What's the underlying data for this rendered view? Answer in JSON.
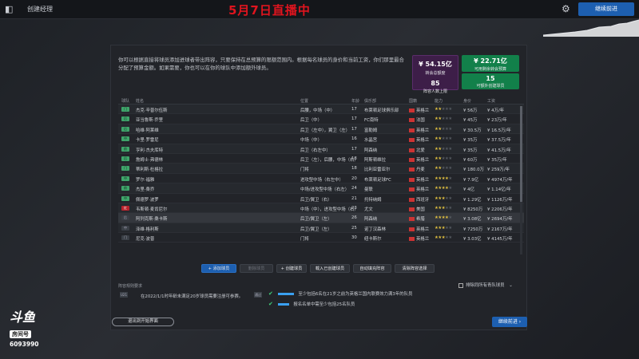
{
  "window": {
    "title": "创建经理",
    "banner": "5月7日直播中",
    "continue_label": "继续前进"
  },
  "intro_text": "你可以根据直接将球员添加进球者带出阵容，只要保持在总预算的限额范围内。根据每名球员的身价和当前工资，你们那里最合分配了预算金额。如果需要，你也可以在你的球队中添加额外球员。",
  "budgets": {
    "transfer": {
      "value": "¥ 54.15亿",
      "label": "转会总额度"
    },
    "wage": {
      "value": "¥ 22.71亿",
      "label": "可用剩余转会预算"
    },
    "squad_count": {
      "value": "85",
      "label": "阵容人数上限"
    },
    "remaining": {
      "value": "15",
      "label": "可额外创建球员"
    }
  },
  "table": {
    "columns": [
      "球队",
      "姓名",
      "位置",
      "年龄",
      "俱乐部",
      "国籍",
      "能力",
      "身价",
      "工资"
    ],
    "rows": [
      {
        "tag": "门",
        "name": "杰克·辛普尔伍斯",
        "pos": "后腰，中场（中）",
        "age": "17",
        "club": "布莱顿足球俱乐部",
        "nat": "英格兰",
        "stars": 2,
        "value": "¥ 56万",
        "wage": "¥ 4万/年"
      },
      {
        "tag": "后",
        "name": "亚当鲁斯·乔里",
        "pos": "后卫（中）",
        "age": "17",
        "club": "FC南特",
        "nat": "法国",
        "stars": 2,
        "value": "¥ 45万",
        "wage": "¥ 23万/年"
      },
      {
        "tag": "后",
        "name": "哈维·阿莱维",
        "pos": "后卫（左中），翼卫（左）",
        "age": "17",
        "club": "富勒姆",
        "nat": "英格兰",
        "stars": 2,
        "value": "¥ 30.5万",
        "wage": "¥ 16.5万/年"
      },
      {
        "tag": "中",
        "name": "卡里·罗雷尼",
        "pos": "中场（中）",
        "age": "16",
        "club": "水晶宫",
        "nat": "英格兰",
        "stars": 2,
        "value": "¥ 35万",
        "wage": "¥ 37.5万/年"
      },
      {
        "tag": "前",
        "name": "亨利·杰夫库特",
        "pos": "后卫（右左中）",
        "age": "17",
        "club": "阿森纳",
        "nat": "北爱",
        "stars": 2,
        "value": "¥ 35万",
        "wage": "¥ 41.5万/年"
      },
      {
        "tag": "后",
        "name": "詹姆士·弗德林",
        "pos": "后卫（左），后腰，中场（右）",
        "age": "18",
        "club": "阿斯顿维拉",
        "nat": "英格兰",
        "stars": 2,
        "value": "¥ 60万",
        "wage": "¥ 35万/年"
      },
      {
        "tag": "门",
        "name": "蒂利斯·杜格拉",
        "pos": "门将",
        "age": "18",
        "club": "比利亚雷亚尔",
        "nat": "丹麦",
        "stars": 2,
        "value": "¥ 180.0万",
        "wage": "¥ 259万/年"
      },
      {
        "tag": "中",
        "name": "罗尔·福雅",
        "pos": "进攻型中场（右左中）",
        "age": "20",
        "club": "布莱顿足球FC",
        "nat": "英格兰",
        "stars": 4,
        "value": "¥ 7.9亿",
        "wage": "¥ 4974万/年"
      },
      {
        "tag": "前",
        "name": "杰里·桑乔",
        "pos": "中场/进攻型中场（右左）",
        "age": "24",
        "club": "曼联",
        "nat": "英格兰",
        "stars": 4,
        "value": "¥ 4亿",
        "wage": "¥ 1.14亿/年"
      },
      {
        "tag": "中",
        "name": "佩德罗·波罗",
        "pos": "后卫/翼卫（右）",
        "age": "21",
        "club": "托特纳姆",
        "nat": "西班牙",
        "stars": 3,
        "value": "¥ 1.29亿",
        "wage": "¥ 1126万/年"
      },
      {
        "tag": "红",
        "name": "韦斯顿·麦肯尼尔",
        "pos": "中场（中），进攻型中场（右）",
        "age": "23",
        "club": "尤文",
        "nat": "美国",
        "stars": 3,
        "value": "¥ 8250万",
        "wage": "¥ 2206万/年"
      },
      {
        "tag": "后",
        "name": "阿列克斯·桑卡斯",
        "pos": "后卫/翼卫（左）",
        "age": "26",
        "club": "阿森纳",
        "nat": "希腊",
        "stars": 4,
        "value": "¥ 3.08亿",
        "wage": "¥ 2694万/年"
      },
      {
        "tag": "中",
        "name": "泽维·格利斯",
        "pos": "后卫/翼卫（左）",
        "age": "25",
        "club": "诺丁汉森林",
        "nat": "英格兰",
        "stars": 3,
        "value": "¥ 7250万",
        "wage": "¥ 2167万/年"
      },
      {
        "tag": "门",
        "name": "尼克·波普",
        "pos": "门将",
        "age": "30",
        "club": "纽卡斯尔",
        "nat": "英格兰",
        "stars": 3,
        "value": "¥ 3.03亿",
        "wage": "¥ 4145万/年"
      }
    ]
  },
  "actions": {
    "add_player": "+ 添加球员",
    "remove_player": "删除球员",
    "create_player": "+ 创建球员",
    "load_created": "载入已创建球员",
    "auto_fill": "自动填充阵容",
    "clear_selection": "清除阵容选择"
  },
  "requirements": {
    "header": "阵容规则要求",
    "toggle_label": "排除同所有青队球员",
    "line1": "在2022/1/1时年龄未满足20岁球员需要注册可参赛。",
    "line1_badge": "通过",
    "line2": "至少包括6名在21岁之前为英格兰国内联赛效力满3年的队员",
    "line3": "报名名单中需至少包括25名队员"
  },
  "footer": {
    "exit_label": "退出到开始界面",
    "continue_label": "继续前进 ›"
  },
  "watermark": {
    "brand": "斗鱼",
    "room_label": "房间号",
    "room_id": "6093990"
  },
  "colors": {
    "accent": "#1d5fb0",
    "green": "#12804a",
    "purple": "#3d1e48",
    "banner": "#e0141e"
  }
}
